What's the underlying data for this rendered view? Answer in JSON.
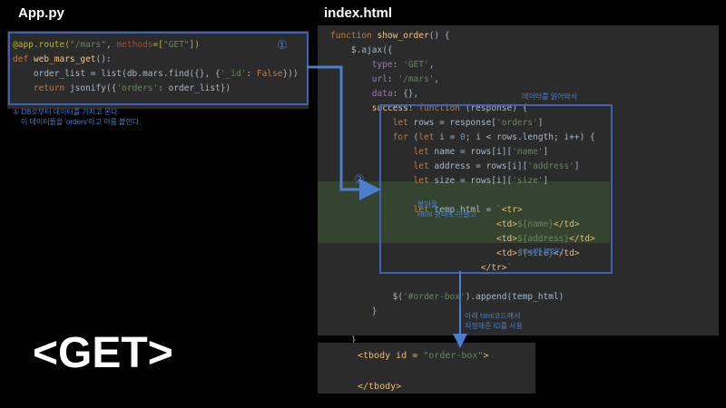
{
  "app_title": "App.py",
  "index_title": "index.html",
  "big_label": "<GET>",
  "step1": "①",
  "step2": "②",
  "app_code": {
    "l1_dec": "@app.route(",
    "l1_str": "\"/mars\"",
    "l1_sep": ", ",
    "l1_param": "methods",
    "l1_eq": "=[",
    "l1_str2": "\"GET\"",
    "l1_end": "])",
    "l2_kw": "def ",
    "l2_fn": "web_mars_get",
    "l2_end": "():",
    "l3_a": "    order_list = list(db.mars.find({}, {",
    "l3_str": "'_id'",
    "l3_b": ": ",
    "l3_kw": "False",
    "l3_c": "}))",
    "l4_kw": "    return ",
    "l4_a": "jsonify({",
    "l4_str": "'orders'",
    "l4_b": ": order_list})"
  },
  "app_note": "① DB로부터 데이터를 가지고 온다.\n    이 데이터들을 'orders'라고 이름 붙인다.",
  "index_code": {
    "c1_kw": "function ",
    "c1_fn": "show_order",
    "c1_end": "() {",
    "c2": "    $.ajax({",
    "c3_p": "        type",
    "c3_b": ": ",
    "c3_s": "'GET'",
    "c3_e": ",",
    "c4_p": "        url",
    "c4_b": ": ",
    "c4_s": "'/mars'",
    "c4_e": ",",
    "c5_p": "        data",
    "c5_b": ": {},",
    "c6_p": "        success",
    "c6_b": ": ",
    "c6_kw": "function ",
    "c6_e": "(response) {",
    "c7_kw": "            let ",
    "c7_a": "rows = response[",
    "c7_s": "'orders'",
    "c7_e": "]",
    "c8_kw": "            for ",
    "c8_a": "(",
    "c8_kw2": "let ",
    "c8_b": "i = ",
    "c8_n": "0",
    "c8_c": "; i < rows.length; i++) {",
    "c9_kw": "                let ",
    "c9_a": "name = rows[i][",
    "c9_s": "'name'",
    "c9_e": "]",
    "c10_kw": "                let ",
    "c10_a": "address = rows[i][",
    "c10_s": "'address'",
    "c10_e": "]",
    "c11_kw": "                let ",
    "c11_a": "size = rows[i][",
    "c11_s": "'size'",
    "c11_e": "]",
    "c12_kw": "                let ",
    "c12_a": "temp_html = ",
    "c12_s": "`",
    "c12_t": "<tr>",
    "c13_t1": "<td>",
    "c13_v": "${name}",
    "c13_t2": "</td>",
    "c14_t1": "<td>",
    "c14_v": "${address}",
    "c14_t2": "</td>",
    "c15_t1": "<td>",
    "c15_v": "${size}",
    "c15_t2": "</td>",
    "c16_t": "</tr>",
    "c16_s": "`",
    "c17_a": "            $(",
    "c17_s": "'#order-box'",
    "c17_b": ").append(temp_html)",
    "c18": "        }",
    "c19": "    }",
    "c20": "    });",
    "c21": "}"
  },
  "notes": {
    "read_data": "데이터를 읽어와서",
    "attach": "붙여줄\nHtml 형태로 만들고",
    "append": "Html에 붙인다.",
    "target": "아래 html코드에서\n지정해준 ID를 사용"
  },
  "tbody_code": {
    "open_a": "<tbody id = ",
    "open_s": "\"order-box\"",
    "open_b": ">",
    "close": "</tbody>"
  }
}
